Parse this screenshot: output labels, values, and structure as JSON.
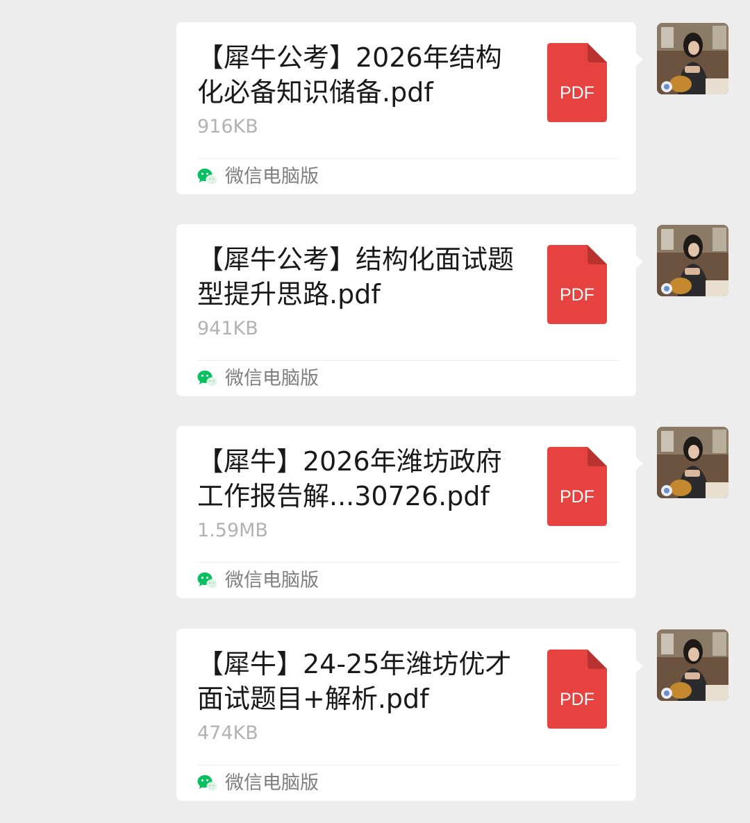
{
  "messages": [
    {
      "file_name": "【犀牛公考】2026年结构化必备知识储备.pdf",
      "file_size": "916KB",
      "file_type_label": "PDF",
      "source_label": "微信电脑版"
    },
    {
      "file_name": "【犀牛公考】结构化面试题型提升思路.pdf",
      "file_size": "941KB",
      "file_type_label": "PDF",
      "source_label": "微信电脑版"
    },
    {
      "file_name": "【犀牛】2026年潍坊政府工作报告解...30726.pdf",
      "file_size": "1.59MB",
      "file_type_label": "PDF",
      "source_label": "微信电脑版"
    },
    {
      "file_name": "【犀牛】24-25年潍坊优才面试题目+解析.pdf",
      "file_size": "474KB",
      "file_type_label": "PDF",
      "source_label": "微信电脑版"
    }
  ],
  "colors": {
    "background": "#ededed",
    "bubble": "#ffffff",
    "pdf_red": "#e64340",
    "wechat_green": "#07c160",
    "file_size_gray": "#b2b2b2",
    "source_gray": "#7f7f7f"
  },
  "icons": {
    "file": "pdf-file-icon",
    "source": "wechat-logo-icon",
    "avatar": "user-avatar"
  }
}
